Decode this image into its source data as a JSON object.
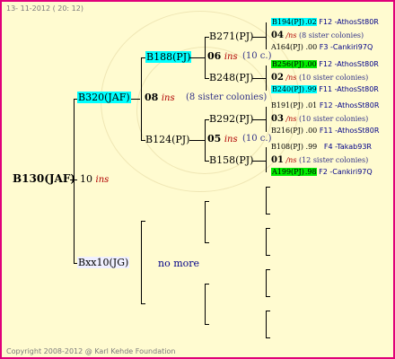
{
  "header": {
    "date": "13- 11-2012 ( 20: 12)"
  },
  "footer": {
    "copyright": "Copyright 2008-2012 @ Karl Kehde Foundation"
  },
  "colors": {
    "border": "#e0007a",
    "background": "#fffbd0",
    "cyan": "#00ffff",
    "green": "#00ee00",
    "ins_red": "#b00000",
    "note_blue": "#333388",
    "f_navy": "#000088"
  },
  "root": {
    "id": "B130(JAF)",
    "value": "10",
    "ins": "ins"
  },
  "gen1": {
    "top": {
      "id": "B320(JAF)",
      "value": "08",
      "ins": "ins",
      "note": "(8 sister colonies)"
    },
    "bottom": {
      "id": "Bxx10(JG)",
      "note": "no more"
    }
  },
  "gen2": {
    "top": {
      "id": "B188(PJ)",
      "value": "06",
      "ins": "ins",
      "note": "(10 c.)"
    },
    "bottom": {
      "id": "B124(PJ)",
      "value": "05",
      "ins": "ins",
      "note": "(10 c.)"
    }
  },
  "gen3": [
    {
      "id": "B271(PJ)"
    },
    {
      "id": "B248(PJ)"
    },
    {
      "id": "B292(PJ)"
    },
    {
      "id": "B158(PJ)"
    }
  ],
  "gen4": [
    {
      "top": {
        "id": "B194(PJ)",
        "suffix": ".02",
        "f": "F12 -AthosSt80R"
      },
      "mid": {
        "value": "04",
        "ins": "/ns",
        "note": "(8 sister colonies)"
      },
      "bottom": {
        "id": "A164(PJ)",
        "suffix": ".00",
        "f": "F3 -Cankiri97Q"
      }
    },
    {
      "top": {
        "id": "B256(PJ)",
        "suffix": ".00",
        "f": "F12 -AthosSt80R"
      },
      "mid": {
        "value": "02",
        "ins": "/ns",
        "note": "(10 sister colonies)"
      },
      "bottom": {
        "id": "B240(PJ)",
        "suffix": ".99",
        "f": "F11 -AthosSt80R"
      }
    },
    {
      "top": {
        "id": "B191(PJ)",
        "suffix": ".01",
        "f": "F12 -AthosSt80R"
      },
      "mid": {
        "value": "03",
        "ins": "/ns",
        "note": "(10 sister colonies)"
      },
      "bottom": {
        "id": "B216(PJ)",
        "suffix": ".00",
        "f": "F11 -AthosSt80R"
      }
    },
    {
      "top": {
        "id": "B108(PJ)",
        "suffix": ".99",
        "f": "F4 -Takab93R"
      },
      "mid": {
        "value": "01",
        "ins": "/ns",
        "note": "(12 sister colonies)"
      },
      "bottom": {
        "id": "A199(PJ)",
        "suffix": ".98",
        "f": "F2 -Cankiri97Q"
      }
    }
  ]
}
